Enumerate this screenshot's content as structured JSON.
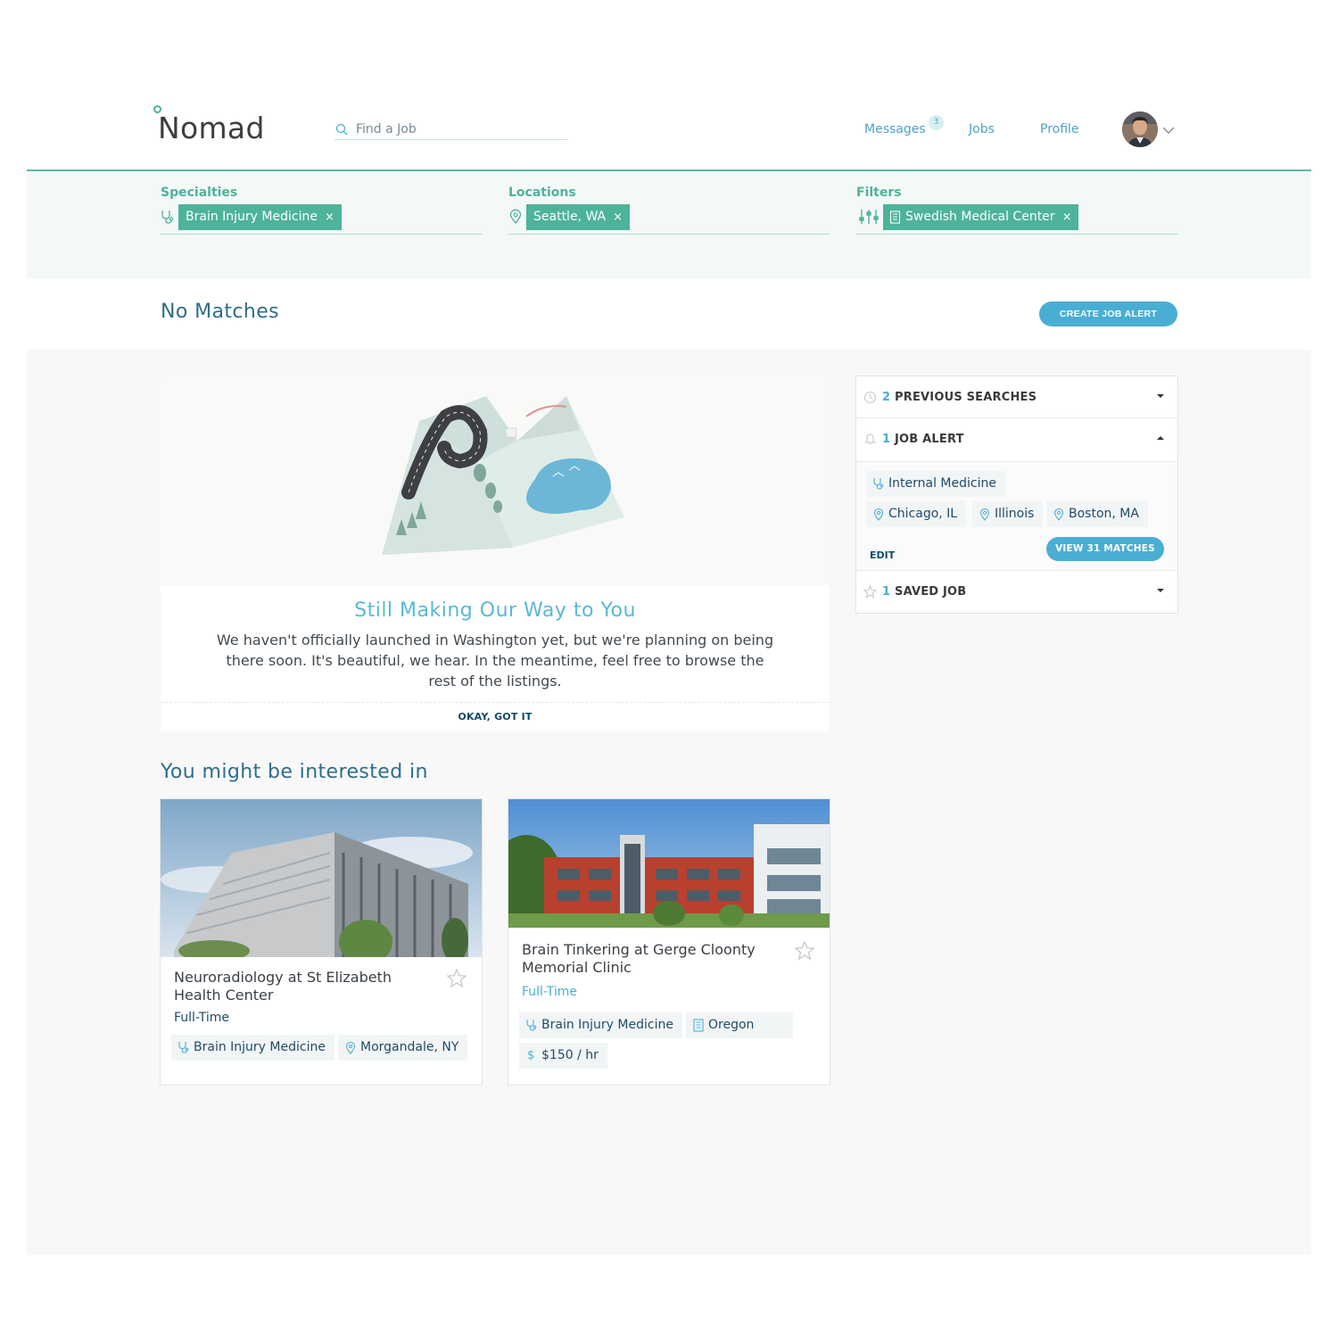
{
  "header": {
    "logo": "Nomad",
    "search_placeholder": "Find a Job",
    "nav": {
      "messages": "Messages",
      "messages_badge": "3",
      "jobs": "Jobs",
      "profile": "Profile"
    }
  },
  "filters": {
    "specialties": {
      "label": "Specialties",
      "chip": "Brain Injury Medicine"
    },
    "locations": {
      "label": "Locations",
      "chip": "Seattle, WA"
    },
    "filters": {
      "label": "Filters",
      "chip": "Swedish Medical Center"
    },
    "remove_glyph": "×"
  },
  "results": {
    "heading": "No Matches",
    "create_alert": "CREATE JOB ALERT"
  },
  "notice": {
    "title": "Still Making Our Way to You",
    "body": "We haven't officially launched in Washington yet, but we're planning on being there soon. It's beautiful, we hear. In the meantime, feel free to browse the rest of the listings.",
    "ok": "OKAY, GOT IT"
  },
  "sidebar": {
    "previous": {
      "count": "2",
      "label": "PREVIOUS SEARCHES"
    },
    "alert": {
      "count": "1",
      "label": "JOB ALERT",
      "specialty": "Internal Medicine",
      "locations": [
        "Chicago, IL",
        "Illinois",
        "Boston, MA"
      ],
      "edit": "EDIT",
      "view": "VIEW 31 MATCHES"
    },
    "saved": {
      "count": "1",
      "label": "SAVED JOB"
    }
  },
  "interest": {
    "heading": "You might be interested in",
    "cards": [
      {
        "title": "Neuroradiology at St Elizabeth Health Center",
        "type": "Full-Time",
        "specialty": "Brain Injury Medicine",
        "location": "Morgandale, NY"
      },
      {
        "title": "Brain Tinkering at Gerge Cloonty Memorial Clinic",
        "type": "Full-Time",
        "specialty": "Brain Injury Medicine",
        "location": "Oregon",
        "pay": "$150 / hr"
      }
    ]
  },
  "colors": {
    "accent_green": "#4db39a",
    "accent_blue": "#4aaed4",
    "heading_blue": "#2f6d8c"
  }
}
